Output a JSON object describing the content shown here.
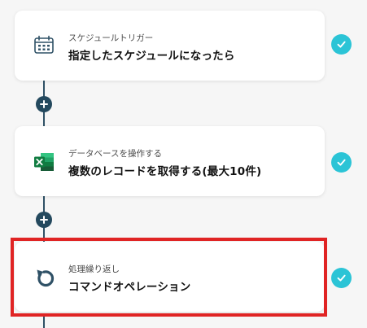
{
  "colors": {
    "check": "#2bc4d6",
    "connector": "#2f5166",
    "highlight": "#e02424",
    "excel": "#1e7145"
  },
  "steps": [
    {
      "subtitle": "スケジュールトリガー",
      "title": "指定したスケジュールになったら",
      "icon": "calendar-clock-icon",
      "completed": true
    },
    {
      "subtitle": "データベースを操作する",
      "title": "複数のレコードを取得する(最大10件)",
      "icon": "excel-icon",
      "completed": true
    },
    {
      "subtitle": "処理繰り返し",
      "title": "コマンドオペレーション",
      "icon": "loop-icon",
      "completed": true,
      "highlighted": true
    }
  ],
  "add_buttons": [
    {
      "icon": "plus-icon"
    },
    {
      "icon": "plus-icon"
    }
  ]
}
